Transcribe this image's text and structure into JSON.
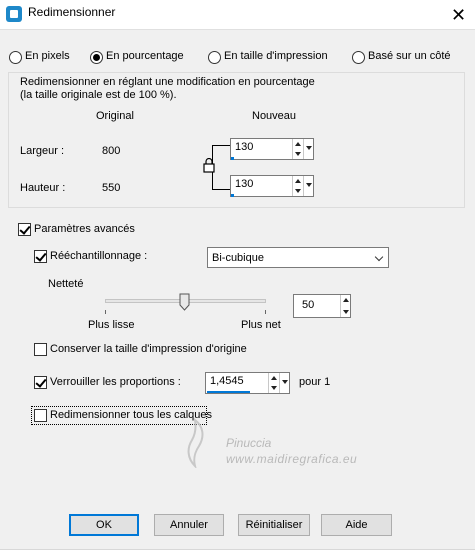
{
  "window": {
    "title": "Redimensionner",
    "close_glyph": "✕"
  },
  "mode": {
    "options": [
      "En pixels",
      "En pourcentage",
      "En taille d'impression",
      "Basé sur un côté"
    ],
    "selected": "En pourcentage"
  },
  "group": {
    "description_line1": "Redimensionner en réglant une modification en pourcentage",
    "description_line2": "(la taille originale est de 100 %).",
    "col_original": "Original",
    "col_new": "Nouveau",
    "width_label": "Largeur :",
    "width_original": "800",
    "width_new": "130",
    "height_label": "Hauteur :",
    "height_original": "550",
    "height_new": "130"
  },
  "advanced": {
    "label": "Paramètres avancés",
    "checked": true,
    "resample_label": "Rééchantillonnage :",
    "resample_checked": true,
    "resample_method": "Bi-cubique",
    "sharpness_label": "Netteté",
    "sharpness_min_label": "Plus lisse",
    "sharpness_max_label": "Plus net",
    "sharpness_value": "50",
    "keep_print_size_label": "Conserver la taille d'impression d'origine",
    "keep_print_size_checked": false,
    "lock_ratio_label": "Verrouiller les proportions :",
    "lock_ratio_checked": true,
    "ratio_value": "1,4545",
    "ratio_suffix": "pour 1",
    "resize_all_layers_label": "Redimensionner tous les calques",
    "resize_all_layers_checked": false
  },
  "buttons": {
    "ok": "OK",
    "cancel": "Annuler",
    "reset": "Réinitialiser",
    "help": "Aide"
  },
  "watermark": {
    "line1": "Pinuccia",
    "line2": "www.maidiregrafica.eu"
  },
  "colors": {
    "accent": "#0078d7",
    "background": "#f0f0f0"
  }
}
